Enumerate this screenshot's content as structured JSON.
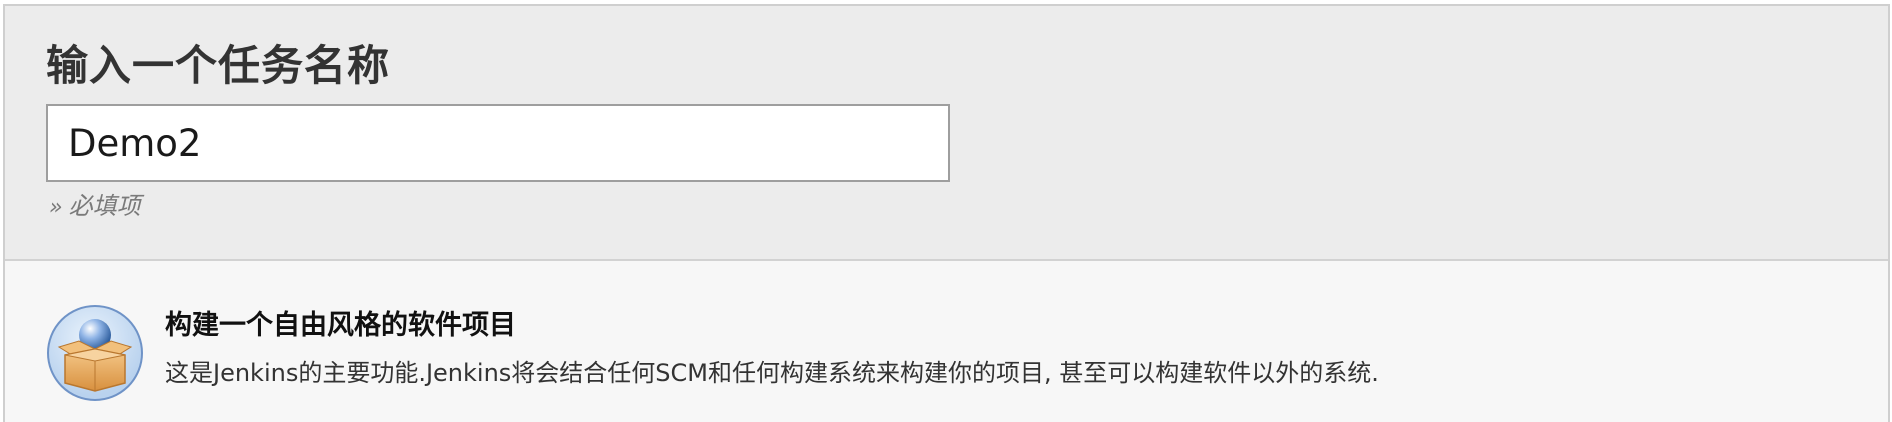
{
  "new_item": {
    "title": "输入一个任务名称",
    "name_value": "Demo2",
    "required_marker": "»",
    "required_text": "必填项"
  },
  "job_types": [
    {
      "title": "构建一个自由风格的软件项目",
      "description": "这是Jenkins的主要功能.Jenkins将会结合任何SCM和任何构建系统来构建你的项目, 甚至可以构建软件以外的系统.",
      "icon": "freestyle-box-icon"
    }
  ],
  "colors": {
    "header_bg": "#ececec",
    "list_bg": "#f7f7f7",
    "icon_blue": "#5b8fd0",
    "icon_box": "#e6a85a"
  }
}
